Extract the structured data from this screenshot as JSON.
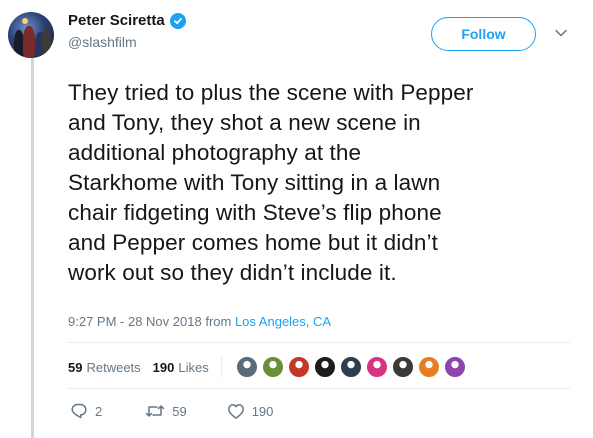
{
  "author": {
    "name": "Peter Sciretta",
    "handle": "@slashfilm"
  },
  "follow_label": "Follow",
  "tweet": {
    "text_lines": [
      "They tried to plus the scene with Pepper",
      "and Tony, they shot a new scene in",
      "additional photography at the",
      "Starkhome with Tony sitting in a lawn",
      "chair fidgeting with Steve’s flip phone",
      "and Pepper comes home but it didn’t",
      "work out so they didn’t include it."
    ],
    "time": "9:27 PM - 28 Nov 2018",
    "from_label": "from",
    "location": "Los Angeles, CA"
  },
  "stats": {
    "retweets_count": "59",
    "retweets_label": "Retweets",
    "likes_count": "190",
    "likes_label": "Likes"
  },
  "likers": [
    {
      "icon": "person-avatar",
      "color": "#5a6b7a"
    },
    {
      "icon": "groot-avatar",
      "color": "#6b8e3a"
    },
    {
      "icon": "santa-avatar",
      "color": "#c0392b"
    },
    {
      "icon": "dark-avatar",
      "color": "#1c1c1c"
    },
    {
      "icon": "robot-avatar",
      "color": "#2c3e50"
    },
    {
      "icon": "pink-avatar",
      "color": "#d63384"
    },
    {
      "icon": "group-avatar",
      "color": "#3a3a3a"
    },
    {
      "icon": "color-avatar",
      "color": "#e67e22"
    },
    {
      "icon": "anime-avatar",
      "color": "#8e44ad"
    }
  ],
  "actions": {
    "replies": "2",
    "retweets": "59",
    "likes": "190"
  },
  "colors": {
    "accent": "#1da1f2",
    "text": "#14171a",
    "muted": "#657786",
    "retweet": "#17bf63",
    "like": "#e0245e"
  }
}
